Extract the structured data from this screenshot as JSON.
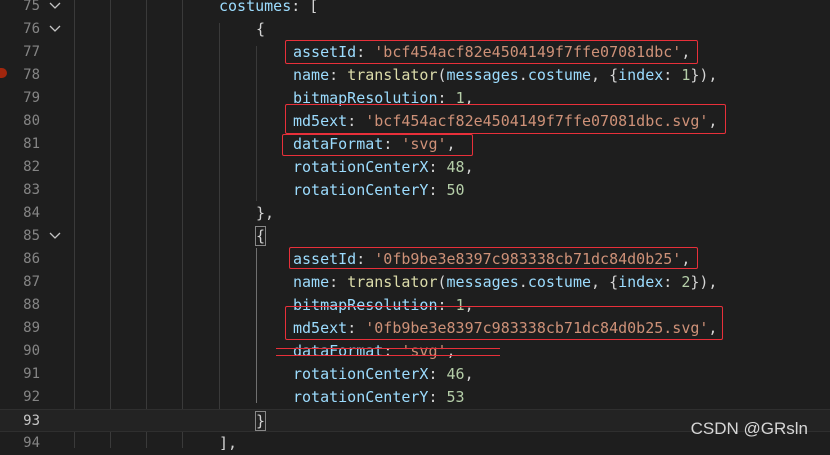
{
  "editor": {
    "lines": [
      {
        "num": "75",
        "fold": true
      },
      {
        "num": "76",
        "fold": true
      },
      {
        "num": "77"
      },
      {
        "num": "78"
      },
      {
        "num": "79"
      },
      {
        "num": "80"
      },
      {
        "num": "81"
      },
      {
        "num": "82"
      },
      {
        "num": "83"
      },
      {
        "num": "84"
      },
      {
        "num": "85",
        "fold": true
      },
      {
        "num": "86"
      },
      {
        "num": "87"
      },
      {
        "num": "88"
      },
      {
        "num": "89"
      },
      {
        "num": "90"
      },
      {
        "num": "91"
      },
      {
        "num": "92"
      },
      {
        "num": "93",
        "current": true
      },
      {
        "num": "94"
      }
    ],
    "code": {
      "l75_key": "costumes",
      "l75_rest": ": [",
      "open_brace": "{",
      "assetId_key": "assetId",
      "asset1_val": "'bcf454acf82e4504149f7ffe07081dbc'",
      "name_key": "name",
      "translator_fn": "translator",
      "messages_obj": "messages",
      "costume_prop": "costume",
      "index_key": "index",
      "idx1": "1",
      "idx2": "2",
      "bitmap_key": "bitmapResolution",
      "bitmap_val": "1",
      "md5_key": "md5ext",
      "md5_1_val": "'bcf454acf82e4504149f7ffe07081dbc.svg'",
      "fmt_key": "dataFormat",
      "fmt_val": "'svg'",
      "rcx_key": "rotationCenterX",
      "rcx1": "48",
      "rcy_key": "rotationCenterY",
      "rcy1": "50",
      "close_brace_comma": "},",
      "asset2_val": "'0fb9be3e8397c983338cb71dc84d0b25'",
      "md5_2_val": "'0fb9be3e8397c983338cb71dc84d0b25.svg'",
      "rcx2": "46",
      "rcy2": "53",
      "close_brace": "}",
      "l94_text": "],"
    }
  },
  "watermark": "CSDN @GRsln",
  "colors": {
    "background": "#1e1e1e",
    "highlight_box": "#e8303a",
    "property": "#9cdcfe",
    "string": "#ce9178",
    "number": "#b5cea8",
    "function": "#dcdcaa"
  }
}
